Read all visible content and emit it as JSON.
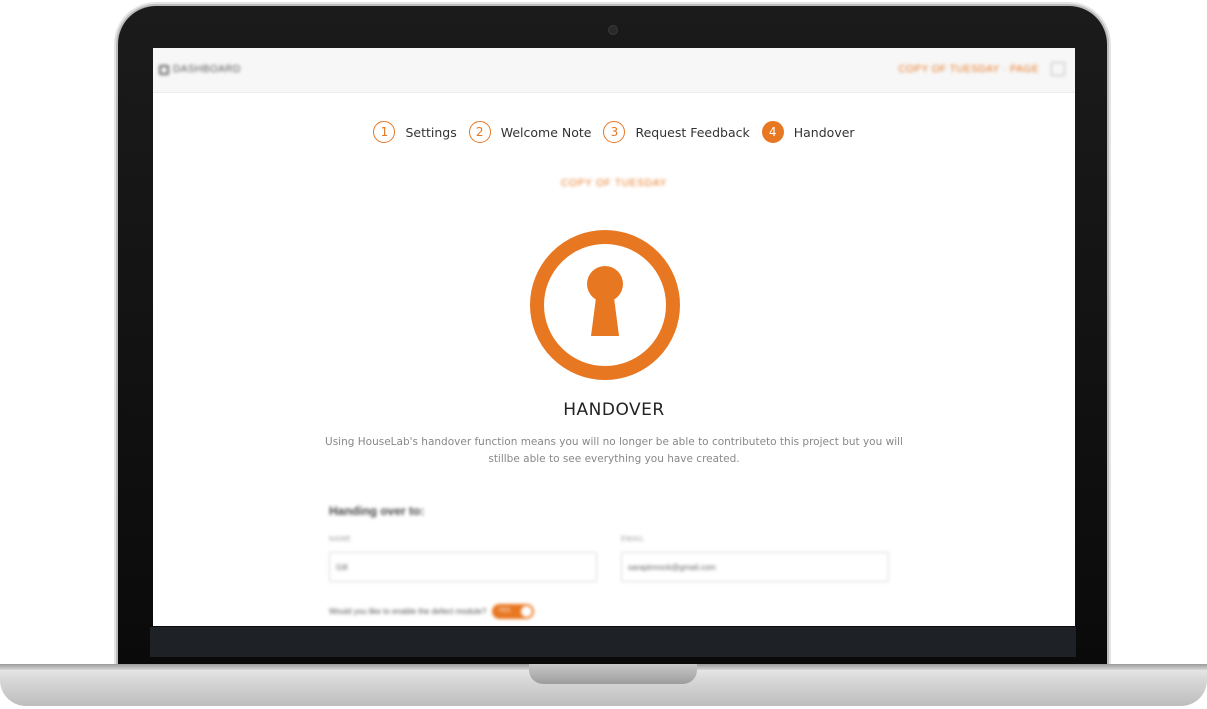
{
  "topbar": {
    "left_label": "DASHBOARD",
    "right_label": "COPY OF TUESDAY · PAGE"
  },
  "stepper": [
    {
      "number": "1",
      "label": "Settings"
    },
    {
      "number": "2",
      "label": "Welcome Note"
    },
    {
      "number": "3",
      "label": "Request Feedback"
    },
    {
      "number": "4",
      "label": "Handover",
      "active": true
    }
  ],
  "project_tag": "COPY OF TUESDAY",
  "main": {
    "title": "HANDOVER",
    "description_line1": "Using HouseLab's handover function means you will no longer be able to contributeto this project but you will",
    "description_line2": "stillbe able to see everything you have created."
  },
  "form": {
    "heading": "Handing over to:",
    "name_label": "NAME",
    "name_value": "Gill",
    "email_label": "EMAIL",
    "email_value": "sarapinnock@gmail.com",
    "toggle_question": "Would you like to enable the defect module?",
    "toggle_value": "YES"
  },
  "colors": {
    "accent": "#e87722"
  },
  "icons": {
    "hero": "keyhole-lock-icon"
  }
}
